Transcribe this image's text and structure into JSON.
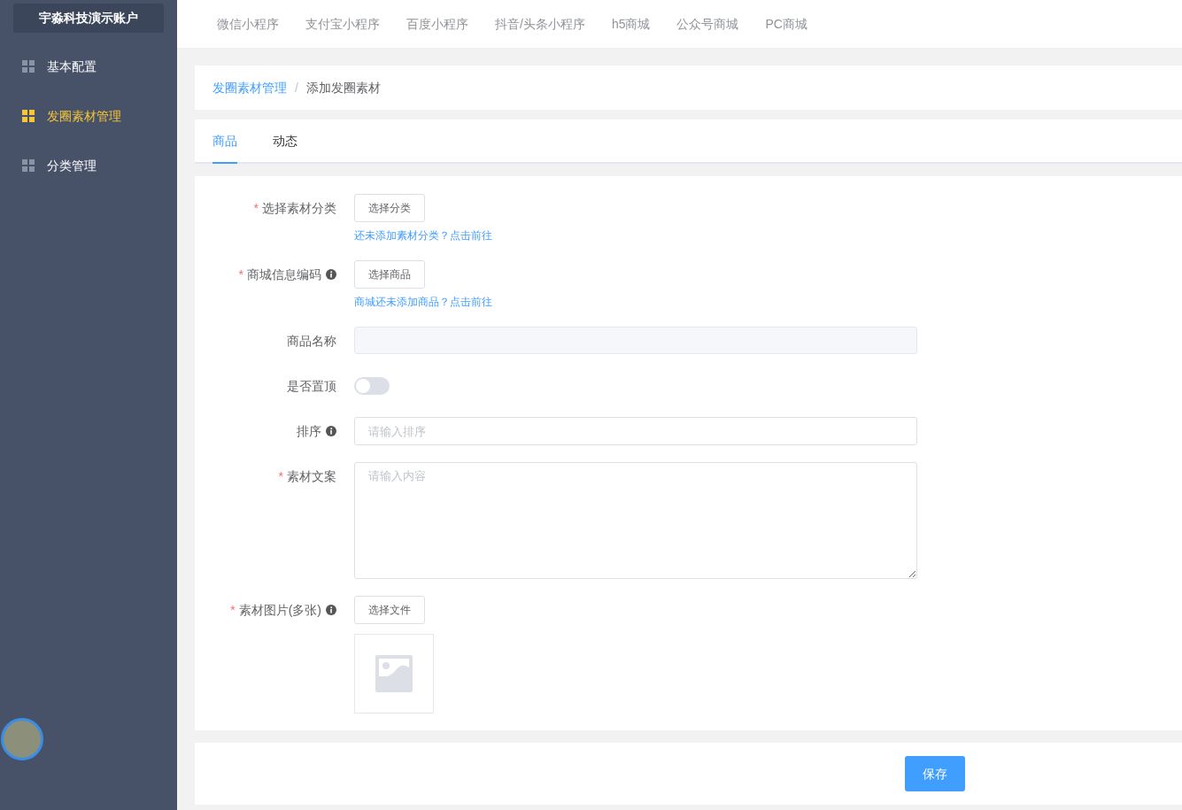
{
  "sidebar": {
    "account": "宇淼科技演示账户",
    "items": [
      {
        "label": "基本配置",
        "selected": false
      },
      {
        "label": "发圈素材管理",
        "selected": true
      },
      {
        "label": "分类管理",
        "selected": false
      }
    ]
  },
  "top_nav": [
    "微信小程序",
    "支付宝小程序",
    "百度小程序",
    "抖音/头条小程序",
    "h5商城",
    "公众号商城",
    "PC商城"
  ],
  "breadcrumb_separator": "/",
  "breadcrumb": [
    {
      "label": "发圈素材管理",
      "kind": "link"
    },
    {
      "label": "添加发圈素材",
      "kind": "current"
    }
  ],
  "tabs": [
    {
      "label": "商品",
      "selected": true
    },
    {
      "label": "动态",
      "selected": false
    }
  ],
  "form": [
    {
      "kind": "picker",
      "label": "选择素材分类",
      "required_mark": "*",
      "info": false,
      "button": "选择分类",
      "hint": "还未添加素材分类？点击前往"
    },
    {
      "kind": "picker",
      "label": "商城信息编码",
      "required_mark": "*",
      "info": true,
      "button": "选择商品",
      "hint": "商城还未添加商品？点击前往"
    },
    {
      "kind": "readonly",
      "label": "商品名称",
      "info": false
    },
    {
      "kind": "switch",
      "label": "是否置顶",
      "info": false,
      "on": false
    },
    {
      "kind": "input",
      "label": "排序",
      "info": true,
      "placeholder": "请输入排序"
    },
    {
      "kind": "textarea",
      "label": "素材文案",
      "required_mark": "*",
      "info": false,
      "placeholder": "请输入内容"
    },
    {
      "kind": "file",
      "label": "素材图片(多张)",
      "required_mark": "*",
      "info": true,
      "button": "选择文件"
    }
  ],
  "save_button": "保存"
}
